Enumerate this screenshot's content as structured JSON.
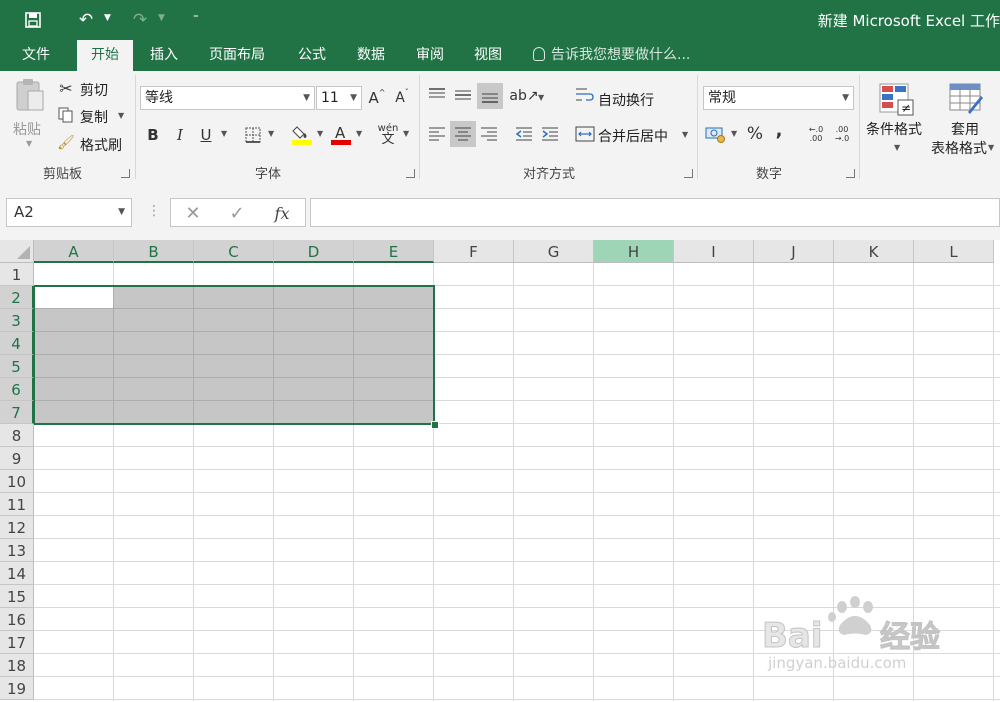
{
  "window": {
    "title": "新建 Microsoft Excel 工作"
  },
  "tabs": [
    "文件",
    "开始",
    "插入",
    "页面布局",
    "公式",
    "数据",
    "审阅",
    "视图"
  ],
  "active_tab": "开始",
  "tell_me": "告诉我您想要做什么...",
  "ribbon": {
    "clipboard": {
      "paste": "粘贴",
      "cut": "剪切",
      "copy": "复制",
      "format_painter": "格式刷",
      "label": "剪贴板"
    },
    "font": {
      "name": "等线",
      "size": "11",
      "bold": "B",
      "italic": "I",
      "underline": "U",
      "label": "字体"
    },
    "alignment": {
      "wrap_text": "自动换行",
      "merge_center": "合并后居中",
      "label": "对齐方式"
    },
    "number": {
      "format": "常规",
      "percent": "%",
      "comma": ",",
      "label": "数字"
    },
    "styles": {
      "conditional_format": "条件格式",
      "table_format_1": "套用",
      "table_format_2": "表格格式"
    }
  },
  "formula_bar": {
    "name_box": "A2",
    "fx": "fx",
    "content": ""
  },
  "grid": {
    "columns": [
      "A",
      "B",
      "C",
      "D",
      "E",
      "F",
      "G",
      "H",
      "I",
      "J",
      "K",
      "L"
    ],
    "rows": [
      "1",
      "2",
      "3",
      "4",
      "5",
      "6",
      "7",
      "8",
      "9",
      "10",
      "11",
      "12",
      "13",
      "14",
      "15",
      "16",
      "17",
      "18",
      "19"
    ],
    "active_cell": "A2",
    "selection": "A2:E7",
    "highlighted_column": "H"
  },
  "colors": {
    "brand": "#217346",
    "selection_fill": "#c6c6c6",
    "highlight_header": "#9fd5b7"
  },
  "watermark": {
    "text_main": "Bai",
    "text_brand": "经验",
    "url": "jingyan.baidu.com"
  }
}
